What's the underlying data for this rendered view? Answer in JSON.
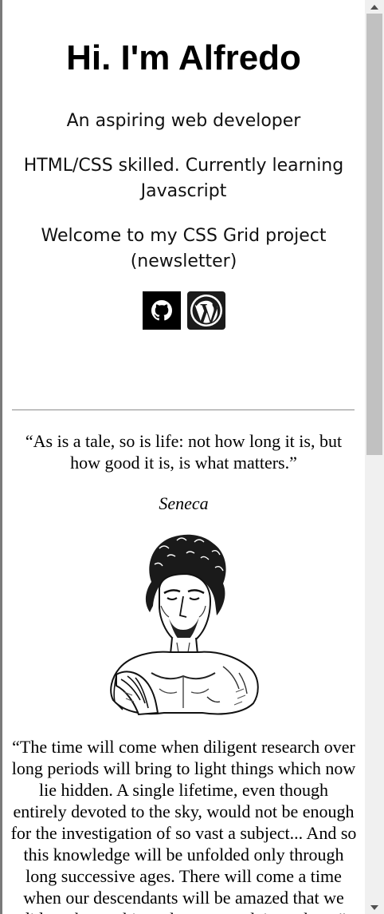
{
  "hero": {
    "title": "Hi. I'm Alfredo",
    "tagline": "An aspiring web developer",
    "skills": "HTML/CSS skilled. Currently learning Javascript",
    "welcome": "Welcome to my CSS Grid project (newsletter)"
  },
  "social": {
    "links": [
      {
        "icon": "github-icon",
        "bg": "#000000"
      },
      {
        "icon": "wordpress-icon",
        "bg": "#ffffff"
      }
    ]
  },
  "quote": {
    "text": "“As is a tale, so is life: not how long it is, but how good it is, is what matters.”",
    "author": "Seneca"
  },
  "long_quote": {
    "text": "“The time will come when diligent research over long periods will bring to light things which now lie hidden. A single lifetime, even though entirely devoted to the sky, would not be enough for the investigation of so vast a subject... And so this knowledge will be unfolded only through long successive ages. There will come a time when our descendants will be amazed that we did not know things that are so plain to them.”"
  },
  "colors": {
    "divider": "#8c8c8c",
    "scroll_thumb": "#c1c1c1",
    "scroll_track": "#f0f0f0"
  }
}
